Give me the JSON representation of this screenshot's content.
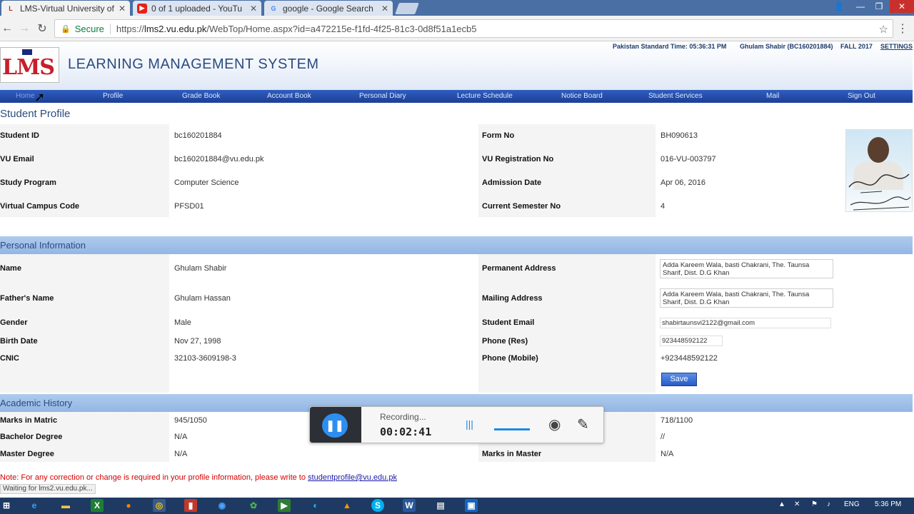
{
  "browser": {
    "tabs": [
      {
        "title": "LMS-Virtual University of",
        "favicon": "lms-icon",
        "active": true
      },
      {
        "title": "0 of 1 uploaded - YouTu",
        "favicon": "youtube-icon",
        "active": false
      },
      {
        "title": "google - Google Search",
        "favicon": "google-icon",
        "active": false
      }
    ],
    "secure_label": "Secure",
    "url_scheme": "https://",
    "url_host": "lms2.vu.edu.pk",
    "url_path": "/WebTop/Home.aspx?id=a472215e-f1fd-4f25-81c3-0d8f51a1ecb5"
  },
  "header": {
    "logo_text": "LMS",
    "title": "LEARNING MANAGEMENT SYSTEM",
    "time": "Pakistan Standard Time: 05:36:31 PM",
    "user": "Ghulam Shabir (BC160201884)",
    "term": "FALL 2017",
    "settings": "SETTINGS"
  },
  "nav": [
    "Home",
    "Profile",
    "Grade Book",
    "Account Book",
    "Personal Diary",
    "Lecture Schedule",
    "Notice Board",
    "Student Services",
    "Mail",
    "Sign Out"
  ],
  "profile": {
    "title": "Student Profile",
    "left": [
      {
        "label": "Student ID",
        "value": "bc160201884"
      },
      {
        "label": "VU Email",
        "value": "bc160201884@vu.edu.pk"
      },
      {
        "label": "Study Program",
        "value": "Computer Science"
      },
      {
        "label": "Virtual Campus Code",
        "value": "PFSD01"
      }
    ],
    "right": [
      {
        "label": "Form No",
        "value": "BH090613"
      },
      {
        "label": "VU Registration No",
        "value": "016-VU-003797"
      },
      {
        "label": "Admission Date",
        "value": "Apr 06, 2016"
      },
      {
        "label": "Current Semester No",
        "value": "4"
      }
    ]
  },
  "personal": {
    "title": "Personal Information",
    "left": [
      {
        "label": "Name",
        "value": "Ghulam Shabir"
      },
      {
        "label": "Father's Name",
        "value": "Ghulam Hassan"
      },
      {
        "label": "Gender",
        "value": "Male"
      },
      {
        "label": "Birth Date",
        "value": "Nov 27, 1998"
      },
      {
        "label": "CNIC",
        "value": "32103-3609198-3"
      }
    ],
    "right_labels": [
      "Permanent Address",
      "Mailing Address",
      "Student Email",
      "Phone (Res)",
      "Phone (Mobile)"
    ],
    "permanent_address": "Adda Kareem Wala, basti Chakrani, The. Taunsa Sharif, Dist. D.G Khan",
    "mailing_address": "Adda Kareem Wala, basti Chakrani, The. Taunsa Sharif, Dist. D.G Khan",
    "student_email": "shabirtaunsvi2122@gmail.com",
    "phone_res": "923448592122",
    "phone_mobile": "+923448592122",
    "save": "Save"
  },
  "academic": {
    "title": "Academic History",
    "left": [
      {
        "label": "Marks in Matric",
        "value": "945/1050"
      },
      {
        "label": "Bachelor Degree",
        "value": "N/A"
      },
      {
        "label": "Master Degree",
        "value": "N/A"
      }
    ],
    "right": [
      {
        "label": "",
        "value": "718/1100"
      },
      {
        "label": "",
        "value": "//"
      },
      {
        "label": "Marks in Master",
        "value": "N/A"
      }
    ]
  },
  "note": {
    "text": "Note: For any correction or change is required in your profile information, please write to ",
    "email": "studentprofile@vu.edu.pk"
  },
  "status_bar": "Waiting for lms2.vu.edu.pk...",
  "recorder": {
    "label": "Recording...",
    "time": "00:02:41"
  },
  "taskbar": {
    "language": "ENG",
    "clock": "5:36 PM"
  }
}
